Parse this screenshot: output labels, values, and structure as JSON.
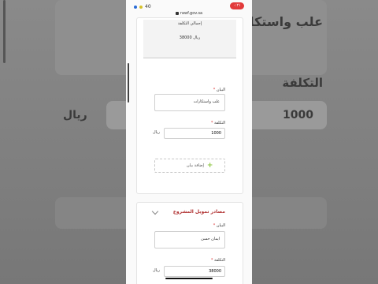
{
  "status_bar": {
    "signal": "40",
    "time": "٠:٢١"
  },
  "browser": {
    "url": "rawf.gov.sa"
  },
  "background": {
    "item_text": "علب واستكا",
    "cost_label": "التكلفة",
    "cost_value": "1000",
    "currency": "ريال"
  },
  "top_card": {
    "title": "إجمالي التكلفة",
    "total": "38000 ريال"
  },
  "item_block": {
    "item_label": "البيان",
    "item_value": "علب واستكارات",
    "cost_label": "التكلفة",
    "currency": "ريال",
    "cost_value": "1000",
    "add_button": "إضافة بيان"
  },
  "funding": {
    "title": "مصادر تمويل المشروع",
    "item_label": "البيان",
    "item_value": "ايمان حسن",
    "cost_label": "التكلفة",
    "currency": "ريال",
    "cost_value": "38000"
  }
}
